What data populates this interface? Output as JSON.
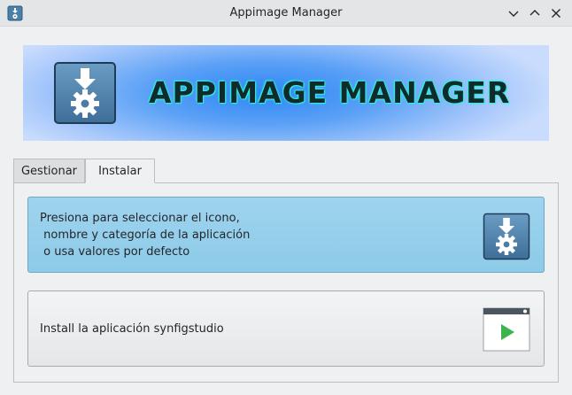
{
  "window": {
    "title": "Appimage Manager",
    "icons": [
      "app-icon",
      "minimize-icon",
      "maximize-icon",
      "close-icon"
    ]
  },
  "banner": {
    "text": "APPIMAGE MANAGER",
    "icon": "appimage-gear-icon"
  },
  "tabs": [
    {
      "label": "Gestionar",
      "active": false
    },
    {
      "label": "Instalar",
      "active": true
    }
  ],
  "install_tab": {
    "select_button": {
      "label": "Presiona para seleccionar el icono,\n nombre y categoría de la aplicación\n o usa valores por defecto",
      "icon": "appimage-gear-icon",
      "color": "#8ccbe9"
    },
    "install_button": {
      "label": "Install la aplicación synfigstudio",
      "icon": "play-window-icon",
      "icon_color": "#39b54a"
    }
  }
}
